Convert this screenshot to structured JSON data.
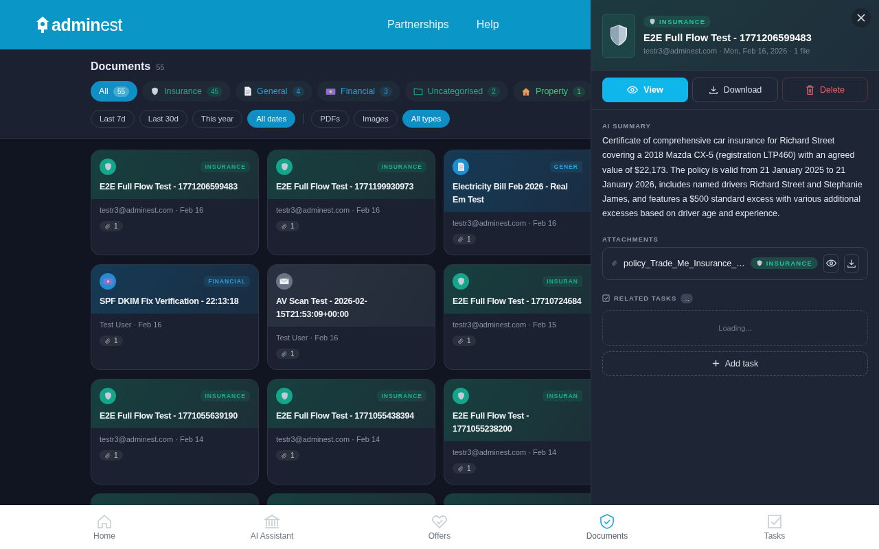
{
  "header": {
    "logo": "**admin**est",
    "nav": [
      "Partnerships",
      "Help"
    ]
  },
  "documents": {
    "title": "Documents",
    "count": "55",
    "categories": [
      {
        "label": "All",
        "count": "55",
        "kind": "all",
        "color": "#ffffff",
        "selected": true
      },
      {
        "label": "Insurance",
        "count": "45",
        "kind": "insurance",
        "color": "#1fae8e",
        "selected": false
      },
      {
        "label": "General",
        "count": "4",
        "kind": "general",
        "color": "#2c9ed8",
        "selected": false
      },
      {
        "label": "Financial",
        "count": "3",
        "kind": "financial",
        "color": "#2c9ed8",
        "selected": false
      },
      {
        "label": "Uncategorised",
        "count": "2",
        "kind": "folder",
        "color": "#1fae8e",
        "selected": false
      },
      {
        "label": "Property",
        "count": "1",
        "kind": "property",
        "color": "#3cc77a",
        "selected": false
      }
    ],
    "dates": [
      {
        "label": "Last 7d",
        "selected": false
      },
      {
        "label": "Last 30d",
        "selected": false
      },
      {
        "label": "This year",
        "selected": false
      },
      {
        "label": "All dates",
        "selected": true
      }
    ],
    "types": [
      {
        "label": "PDFs",
        "selected": false
      },
      {
        "label": "Images",
        "selected": false
      },
      {
        "label": "All types",
        "selected": true
      }
    ],
    "card_rows": [
      [
        {
          "kind": "insurance",
          "badge": "INSURANCE",
          "title": "E2E Full Flow Test - 1771206599483",
          "meta": "testr3@adminest.com · Feb 16",
          "files": "1"
        },
        {
          "kind": "insurance",
          "badge": "INSURANCE",
          "title": "E2E Full Flow Test - 1771199930973",
          "meta": "testr3@adminest.com · Feb 16",
          "files": "1"
        },
        {
          "kind": "general",
          "badge": "GENER",
          "title": "Electricity Bill Feb 2026 - Real Em Test",
          "meta": "testr3@adminest.com · Feb 16",
          "files": "1"
        }
      ],
      [
        {
          "kind": "financial",
          "badge": "FINANCIAL",
          "title": "SPF DKIM Fix Verification - 22:13:18",
          "meta": "Test User · Feb 16",
          "files": "1"
        },
        {
          "kind": "email",
          "title": "AV Scan Test - 2026-02-15T21:53:09+00:00",
          "meta": "Test User · Feb 16",
          "files": "1"
        },
        {
          "kind": "insurance",
          "badge": "INSURAN",
          "title": "E2E Full Flow Test - 17710724684",
          "meta": "testr3@adminest.com · Feb 15",
          "files": "1"
        }
      ],
      [
        {
          "kind": "insurance",
          "badge": "INSURANCE",
          "title": "E2E Full Flow Test - 1771055639190",
          "meta": "testr3@adminest.com · Feb 14",
          "files": "1"
        },
        {
          "kind": "insurance",
          "badge": "INSURANCE",
          "title": "E2E Full Flow Test - 1771055438394",
          "meta": "testr3@adminest.com · Feb 14",
          "files": "1"
        },
        {
          "kind": "insurance",
          "badge": "INSURAN",
          "title": "E2E Full Flow Test - 1771055238200",
          "meta": "testr3@adminest.com · Feb 14",
          "files": "1"
        }
      ]
    ],
    "peek_cards": [
      {
        "kind": "insurance"
      },
      {
        "kind": "insurance"
      },
      {
        "kind": "insurance"
      }
    ]
  },
  "drawer": {
    "badge": "INSURANCE",
    "title": "E2E Full Flow Test - 1771206599483",
    "meta": "testr3@adminest.com · Mon, Feb 16, 2026 · 1 file",
    "actions": [
      {
        "label": "View",
        "kind": "primary"
      },
      {
        "label": "Download",
        "kind": "download"
      },
      {
        "label": "Delete",
        "kind": "danger"
      }
    ],
    "summary_label": "AI SUMMARY",
    "summary": "Certificate of comprehensive car insurance for Richard Street covering a 2018 Mazda CX-5 (registration LTP460) with an agreed value of $22,173. The policy is valid from 21 January 2025 to 21 January 2026, includes named drivers Richard Street and Stephanie James, and features a $500 standard excess with various additional excesses based on driver age and experience.",
    "attachments_label": "ATTACHMENTS",
    "attachments": [
      {
        "name": "policy_Trade_Me_Insurance_…",
        "badge": "INSURANCE"
      }
    ],
    "tasks_label": "RELATED TASKS",
    "tasks_count": "...",
    "tasks_status": "Loading...",
    "add_task": "Add task"
  },
  "bottom_nav": [
    {
      "label": "Home",
      "kind": "home",
      "selected": false
    },
    {
      "label": "AI Assistant",
      "kind": "bank",
      "selected": false
    },
    {
      "label": "Offers",
      "kind": "heart",
      "selected": false
    },
    {
      "label": "Documents",
      "kind": "shield",
      "selected": true
    },
    {
      "label": "Tasks",
      "kind": "tasks",
      "selected": false
    }
  ]
}
